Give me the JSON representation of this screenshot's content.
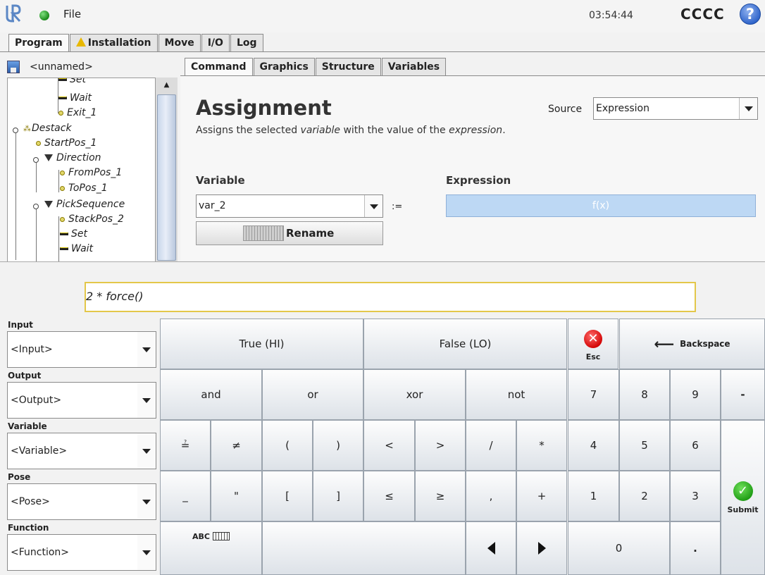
{
  "topbar": {
    "menu": "File",
    "clock": "03:54:44",
    "robot_name": "CCCC",
    "help": "?"
  },
  "main_tabs": [
    {
      "label": "Program",
      "active": true
    },
    {
      "label": "Installation",
      "icon": "warning-icon"
    },
    {
      "label": "Move"
    },
    {
      "label": "I/O"
    },
    {
      "label": "Log"
    }
  ],
  "program": {
    "name": "<unnamed>"
  },
  "tree": [
    {
      "label": "Set",
      "icon": "set-icon"
    },
    {
      "label": "Wait",
      "icon": "wait-icon"
    },
    {
      "label": "Exit_1",
      "icon": "waypoint-icon"
    },
    {
      "label": "Destack",
      "icon": "destack-icon"
    },
    {
      "label": "StartPos_1",
      "icon": "waypoint-icon"
    },
    {
      "label": "Direction",
      "icon": "direction-icon"
    },
    {
      "label": "FromPos_1",
      "icon": "waypoint-icon"
    },
    {
      "label": "ToPos_1",
      "icon": "waypoint-icon"
    },
    {
      "label": "PickSequence",
      "icon": "sequence-icon"
    },
    {
      "label": "StackPos_2",
      "icon": "waypoint-icon"
    },
    {
      "label": "Set",
      "icon": "set-icon"
    },
    {
      "label": "Wait",
      "icon": "wait-icon"
    }
  ],
  "cmd_tabs": [
    {
      "label": "Command",
      "active": true
    },
    {
      "label": "Graphics"
    },
    {
      "label": "Structure"
    },
    {
      "label": "Variables"
    }
  ],
  "assignment": {
    "title": "Assignment",
    "desc_pre": "Assigns the selected ",
    "desc_var": "variable",
    "desc_mid": " with the value of the ",
    "desc_expr": "expression",
    "desc_post": ".",
    "source_label": "Source",
    "source_value": "Expression",
    "variable_label": "Variable",
    "variable_value": "var_2",
    "operator": ":=",
    "expression_label": "Expression",
    "expression_placeholder": "f(x)",
    "rename": "Rename"
  },
  "editor": {
    "expression": "2 * force()",
    "selectors": [
      {
        "label": "Input",
        "value": "<Input>"
      },
      {
        "label": "Output",
        "value": "<Output>"
      },
      {
        "label": "Variable",
        "value": "<Variable>"
      },
      {
        "label": "Pose",
        "value": "<Pose>"
      },
      {
        "label": "Function",
        "value": "<Function>"
      }
    ],
    "keys": {
      "true": "True (HI)",
      "false": "False (LO)",
      "esc": "Esc",
      "backspace": "Backspace",
      "and": "and",
      "or": "or",
      "xor": "xor",
      "not": "not",
      "7": "7",
      "8": "8",
      "9": "9",
      "minus": "-",
      "eq": "≟",
      "neq": "≠",
      "lpar": "(",
      "rpar": ")",
      "lt": "<",
      "gt": ">",
      "div": "/",
      "mul": "*",
      "4": "4",
      "5": "5",
      "6": "6",
      "us": "_",
      "quote": "\"",
      "lbr": "[",
      "rbr": "]",
      "le": "≤",
      "ge": "≥",
      "comma": ",",
      "plus": "+",
      "1": "1",
      "2": "2",
      "3": "3",
      "submit": "Submit",
      "abc": "ABC",
      "0": "0",
      "dot": "."
    }
  }
}
